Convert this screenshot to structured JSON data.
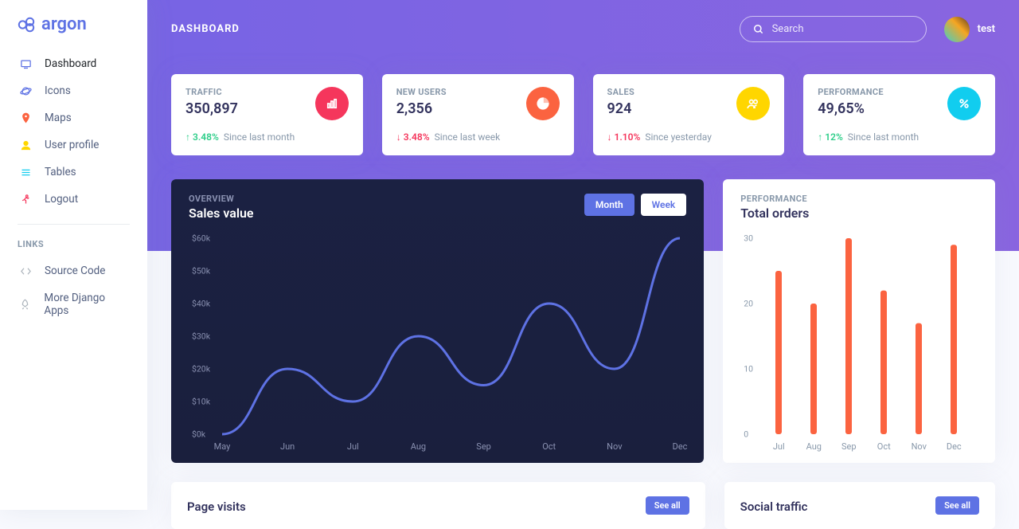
{
  "brand": "argon",
  "page_title": "DASHBOARD",
  "search": {
    "placeholder": "Search"
  },
  "user": {
    "name": "test"
  },
  "sidebar": {
    "items": [
      {
        "label": "Dashboard",
        "icon": "tv",
        "color": "#5e72e4"
      },
      {
        "label": "Icons",
        "icon": "planet",
        "color": "#5e72e4"
      },
      {
        "label": "Maps",
        "icon": "pin",
        "color": "#fb6340"
      },
      {
        "label": "User profile",
        "icon": "user",
        "color": "#ffd600"
      },
      {
        "label": "Tables",
        "icon": "list",
        "color": "#11cdef"
      },
      {
        "label": "Logout",
        "icon": "run",
        "color": "#f5365c"
      }
    ],
    "links_heading": "LINKS",
    "links": [
      {
        "label": "Source Code",
        "icon": "code"
      },
      {
        "label": "More Django Apps",
        "icon": "rocket"
      }
    ]
  },
  "stats": [
    {
      "label": "TRAFFIC",
      "value": "350,897",
      "delta": "3.48%",
      "dir": "up",
      "since": "Since last month",
      "icon": "bar",
      "bg": "#f5365c"
    },
    {
      "label": "NEW USERS",
      "value": "2,356",
      "delta": "3.48%",
      "dir": "down",
      "since": "Since last week",
      "icon": "pie",
      "bg": "#fb6340"
    },
    {
      "label": "SALES",
      "value": "924",
      "delta": "1.10%",
      "dir": "down",
      "since": "Since yesterday",
      "icon": "users",
      "bg": "#ffd600"
    },
    {
      "label": "PERFORMANCE",
      "value": "49,65%",
      "delta": "12%",
      "dir": "up",
      "since": "Since last month",
      "icon": "percent",
      "bg": "#11cdef"
    }
  ],
  "sales_chart": {
    "overline": "OVERVIEW",
    "title": "Sales value",
    "toggle": {
      "month": "Month",
      "week": "Week"
    }
  },
  "orders_chart": {
    "overline": "PERFORMANCE",
    "title": "Total orders"
  },
  "tables": {
    "visits": {
      "title": "Page visits",
      "see_all": "See all"
    },
    "social": {
      "title": "Social traffic",
      "see_all": "See all"
    }
  },
  "chart_data": [
    {
      "type": "line",
      "title": "Sales value",
      "xlabel": "",
      "ylabel": "",
      "x": [
        "May",
        "Jun",
        "Jul",
        "Aug",
        "Sep",
        "Oct",
        "Nov",
        "Dec"
      ],
      "y_ticks": [
        "$0k",
        "$10k",
        "$20k",
        "$30k",
        "$40k",
        "$50k",
        "$60k"
      ],
      "ylim": [
        0,
        60
      ],
      "series": [
        {
          "name": "Sales",
          "values": [
            0,
            20,
            10,
            30,
            15,
            40,
            20,
            60
          ]
        }
      ]
    },
    {
      "type": "bar",
      "title": "Total orders",
      "xlabel": "",
      "ylabel": "",
      "categories": [
        "Jul",
        "Aug",
        "Sep",
        "Oct",
        "Nov",
        "Dec"
      ],
      "y_ticks": [
        "0",
        "10",
        "20",
        "30"
      ],
      "ylim": [
        0,
        30
      ],
      "values": [
        25,
        20,
        30,
        22,
        17,
        29
      ]
    }
  ]
}
